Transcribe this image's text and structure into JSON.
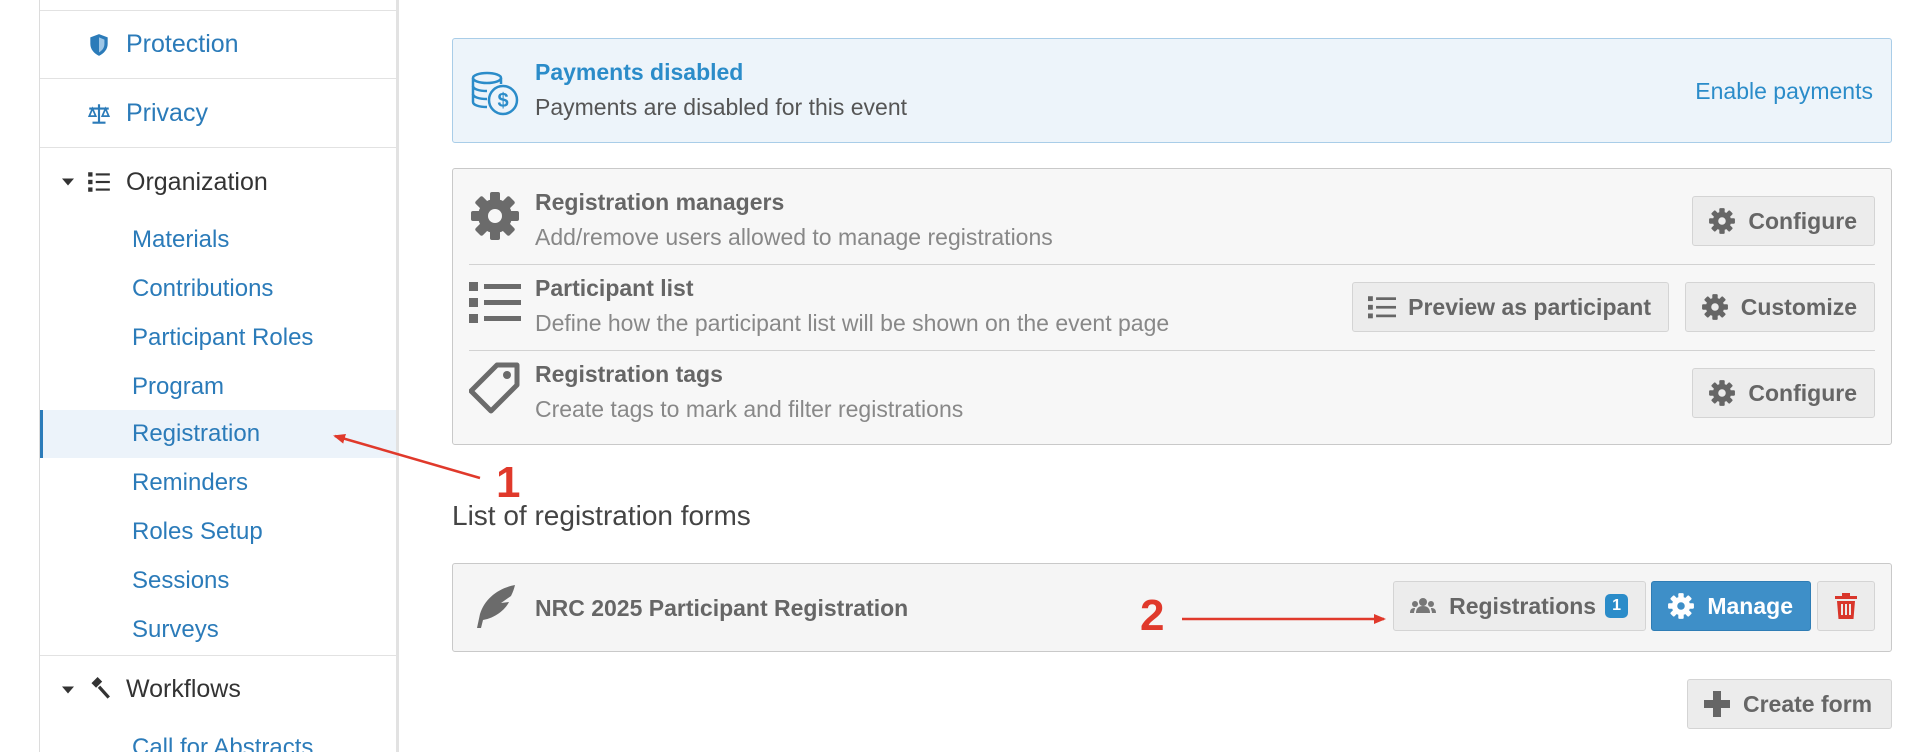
{
  "sidebar": {
    "sections": [
      {
        "label": "Protection",
        "icon": "shield-icon"
      },
      {
        "label": "Privacy",
        "icon": "scale-icon"
      },
      {
        "label": "Organization",
        "icon": "list-icon",
        "expanded": true
      },
      {
        "label": "Workflows",
        "icon": "gavel-icon",
        "expanded": true
      }
    ],
    "organization_items": [
      {
        "label": "Materials"
      },
      {
        "label": "Contributions"
      },
      {
        "label": "Participant Roles"
      },
      {
        "label": "Program"
      },
      {
        "label": "Registration",
        "active": true
      },
      {
        "label": "Reminders"
      },
      {
        "label": "Roles Setup"
      },
      {
        "label": "Sessions"
      },
      {
        "label": "Surveys"
      }
    ],
    "workflow_items": [
      {
        "label": "Call for Abstracts"
      }
    ]
  },
  "payments": {
    "title": "Payments disabled",
    "subtitle": "Payments are disabled for this event",
    "link": "Enable payments",
    "icon": "coins-dollar-icon"
  },
  "options": [
    {
      "title": "Registration managers",
      "subtitle": "Add/remove users allowed to manage registrations",
      "icon": "gear-icon",
      "buttons": [
        {
          "label": "Configure",
          "icon": "gear-icon"
        }
      ]
    },
    {
      "title": "Participant list",
      "subtitle": "Define how the participant list will be shown on the event page",
      "icon": "list-icon",
      "buttons": [
        {
          "label": "Preview as participant",
          "icon": "list-icon"
        },
        {
          "label": "Customize",
          "icon": "gear-icon"
        }
      ]
    },
    {
      "title": "Registration tags",
      "subtitle": "Create tags to mark and filter registrations",
      "icon": "tag-icon",
      "buttons": [
        {
          "label": "Configure",
          "icon": "gear-icon"
        }
      ]
    }
  ],
  "forms": {
    "heading": "List of registration forms",
    "items": [
      {
        "title": "NRC 2025 Participant Registration",
        "icon": "feather-icon",
        "registrations_label": "Registrations",
        "registrations_count": "1",
        "manage_label": "Manage"
      }
    ],
    "create_label": "Create form"
  },
  "annotations": {
    "marker_1": "1",
    "marker_2": "2",
    "color": "#e0392b"
  },
  "colors": {
    "link": "#2b7bb9",
    "primary": "#3e8fc8",
    "danger": "#d9362b",
    "info_bg": "#edf4fa"
  }
}
